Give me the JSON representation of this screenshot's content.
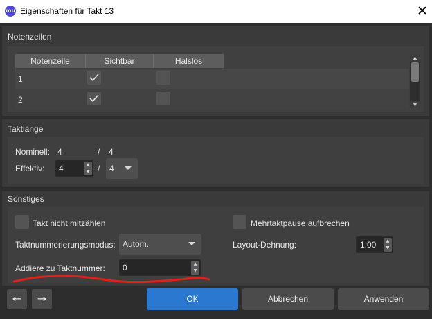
{
  "window": {
    "app_icon_text": "mu",
    "title": "Eigenschaften für Takt 13",
    "close_glyph": "✕"
  },
  "staves_section": {
    "title": "Notenzeilen",
    "columns": [
      "Notenzeile",
      "Sichtbar",
      "Halslos"
    ],
    "rows": [
      {
        "staff": "1",
        "visible": true,
        "stemless": false
      },
      {
        "staff": "2",
        "visible": true,
        "stemless": false
      }
    ]
  },
  "length_section": {
    "title": "Taktlänge",
    "nominal_label": "Nominell:",
    "nominal_numerator": "4",
    "nominal_slash": "/",
    "nominal_denominator": "4",
    "actual_label": "Effektiv:",
    "actual_numerator": "4",
    "actual_slash": "/",
    "actual_denominator": "4"
  },
  "other_section": {
    "title": "Sonstiges",
    "exclude_label": "Takt nicht mitzählen",
    "exclude_checked": false,
    "break_mmrest_label": "Mehrtaktpause aufbrechen",
    "break_mmrest_checked": false,
    "numbering_mode_label": "Taktnummerierungsmodus:",
    "numbering_mode_value": "Autom.",
    "layout_stretch_label": "Layout-Dehnung:",
    "layout_stretch_value": "1,00",
    "add_to_number_label": "Addiere zu Taktnummer:",
    "add_to_number_value": "0"
  },
  "footer": {
    "prev_glyph": "←",
    "next_glyph": "→",
    "ok_label": "OK",
    "cancel_label": "Abbrechen",
    "apply_label": "Anwenden"
  },
  "annotation": {
    "underline_color": "#e0201b"
  },
  "colors": {
    "background": "#2d2d2d",
    "accent": "#2a78cf"
  }
}
